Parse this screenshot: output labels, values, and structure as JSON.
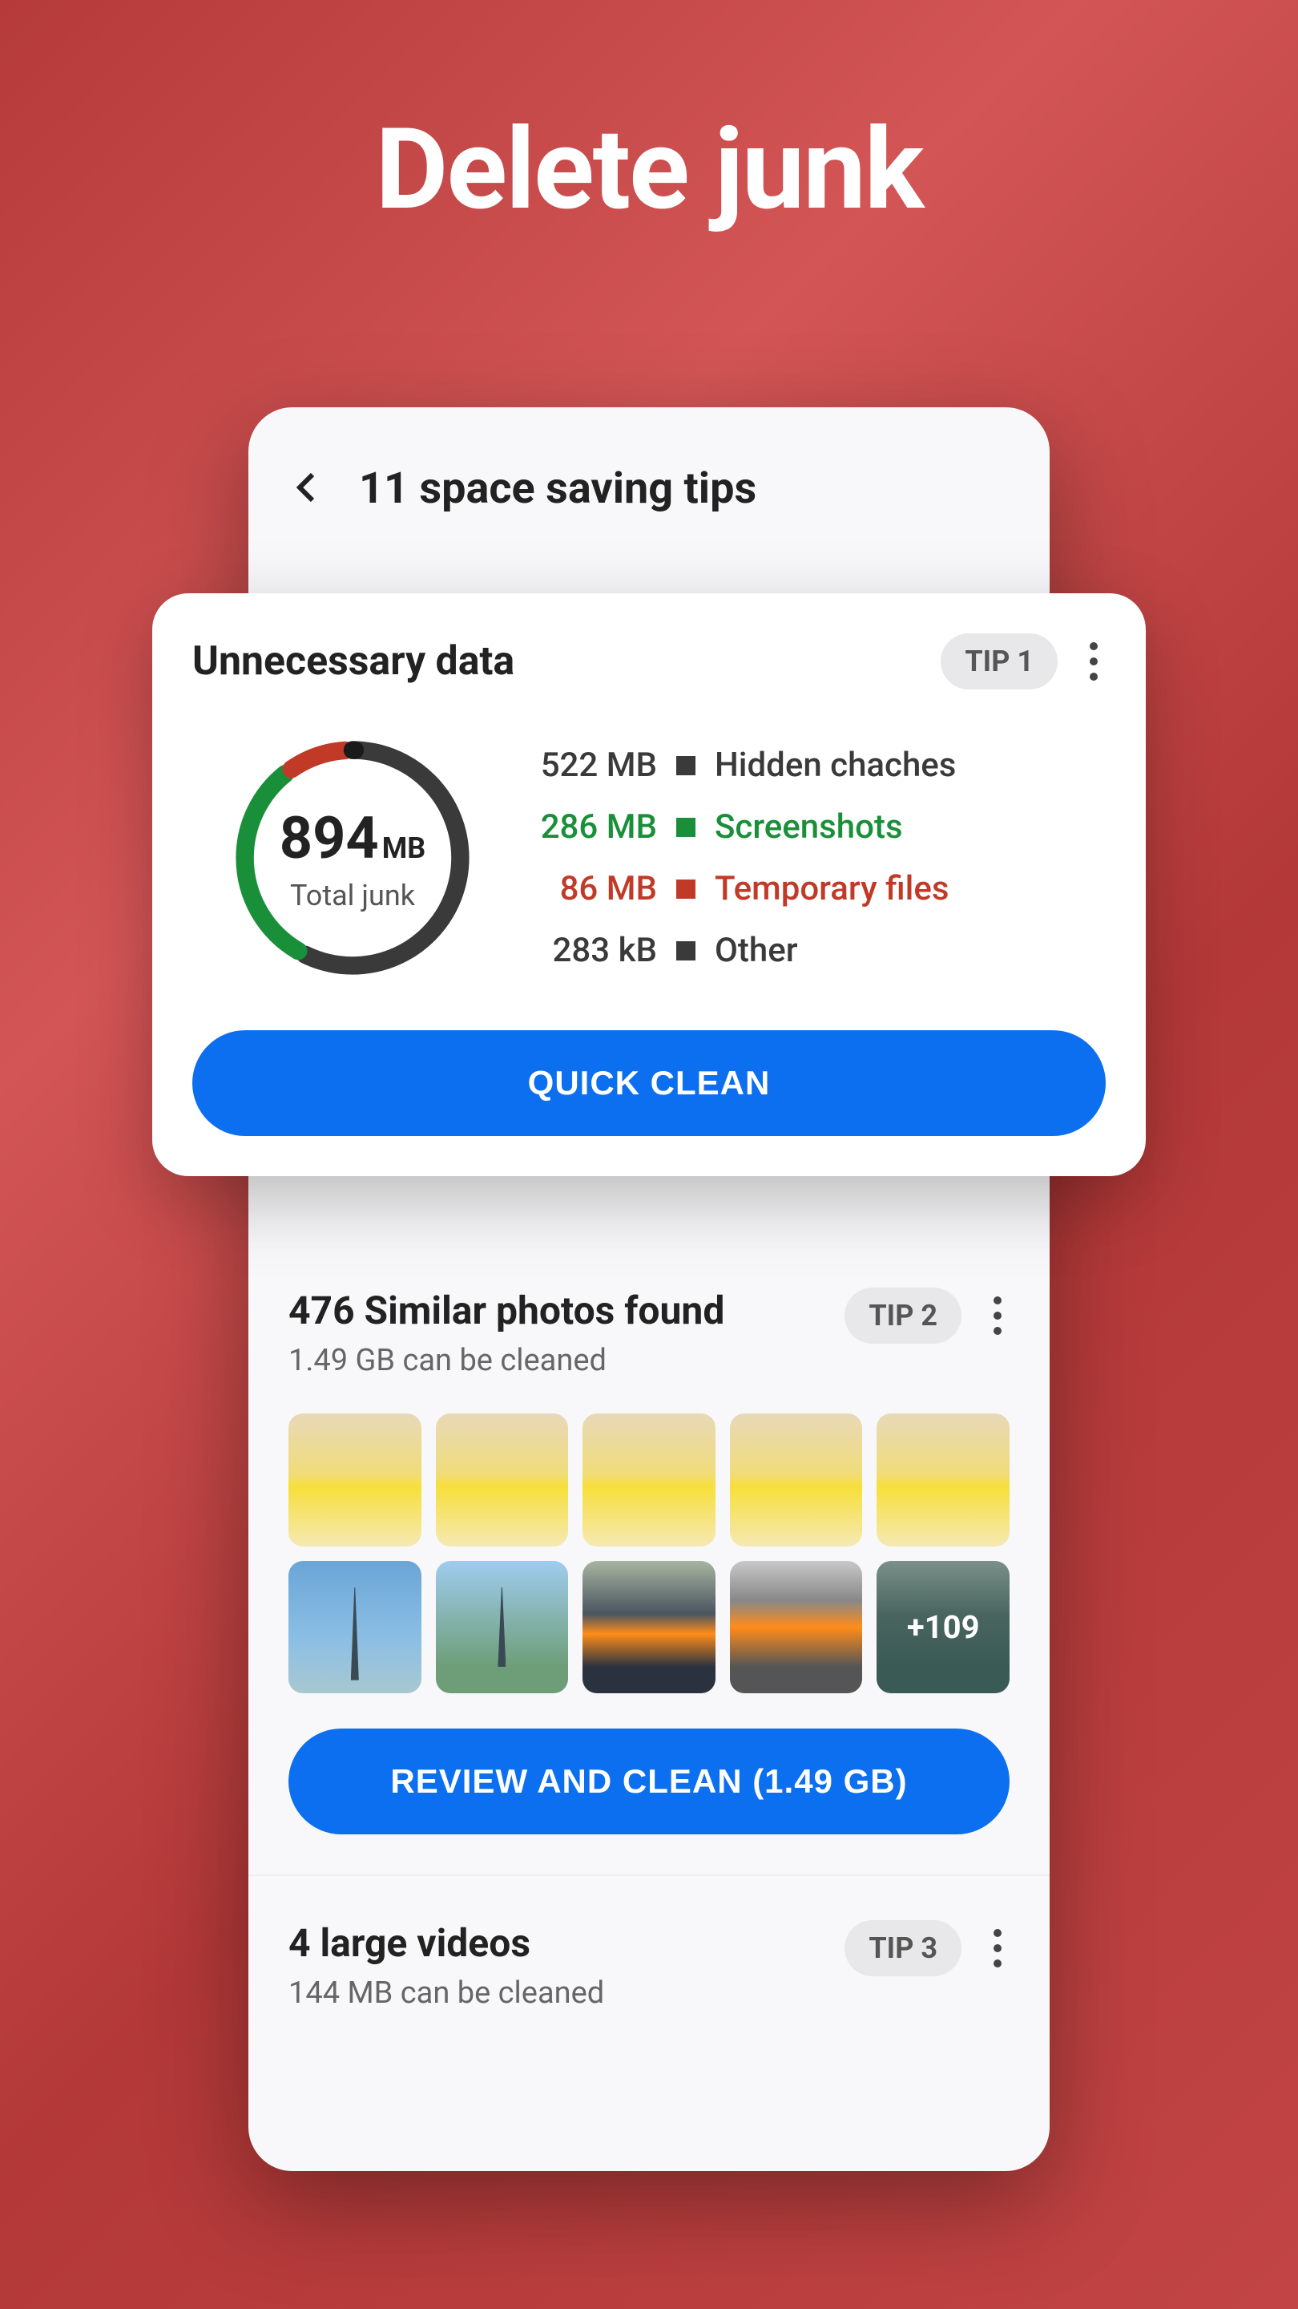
{
  "hero": {
    "title": "Delete junk"
  },
  "app": {
    "page_title": "11 space saving tips"
  },
  "tip1": {
    "title": "Unnecessary data",
    "badge": "TIP 1",
    "total_value": "894",
    "total_unit": "MB",
    "total_label": "Total junk",
    "legend": [
      {
        "size": "522 MB",
        "label": "Hidden chaches",
        "color": "darkgray"
      },
      {
        "size": "286 MB",
        "label": "Screenshots",
        "color": "green"
      },
      {
        "size": "86 MB",
        "label": "Temporary files",
        "color": "red"
      },
      {
        "size": "283 kB",
        "label": "Other",
        "color": "darkgray"
      }
    ],
    "button": "QUICK CLEAN"
  },
  "tip2": {
    "title": "476 Similar photos found",
    "subtitle": "1.49 GB can be cleaned",
    "badge": "TIP 2",
    "overlay_count": "+109",
    "button": "REVIEW AND CLEAN (1.49 GB)"
  },
  "tip3": {
    "title": "4 large videos",
    "subtitle": "144 MB can be cleaned",
    "badge": "TIP 3"
  },
  "chart_data": {
    "type": "pie",
    "title": "Total junk",
    "total": {
      "value": 894,
      "unit": "MB"
    },
    "series": [
      {
        "name": "Hidden chaches",
        "value": 522,
        "unit": "MB",
        "color": "#3a3a3a"
      },
      {
        "name": "Screenshots",
        "value": 286,
        "unit": "MB",
        "color": "#1a8f3a"
      },
      {
        "name": "Temporary files",
        "value": 86,
        "unit": "MB",
        "color": "#c13a28"
      },
      {
        "name": "Other",
        "value": 0.283,
        "unit": "MB",
        "color": "#1a1a1a"
      }
    ]
  }
}
